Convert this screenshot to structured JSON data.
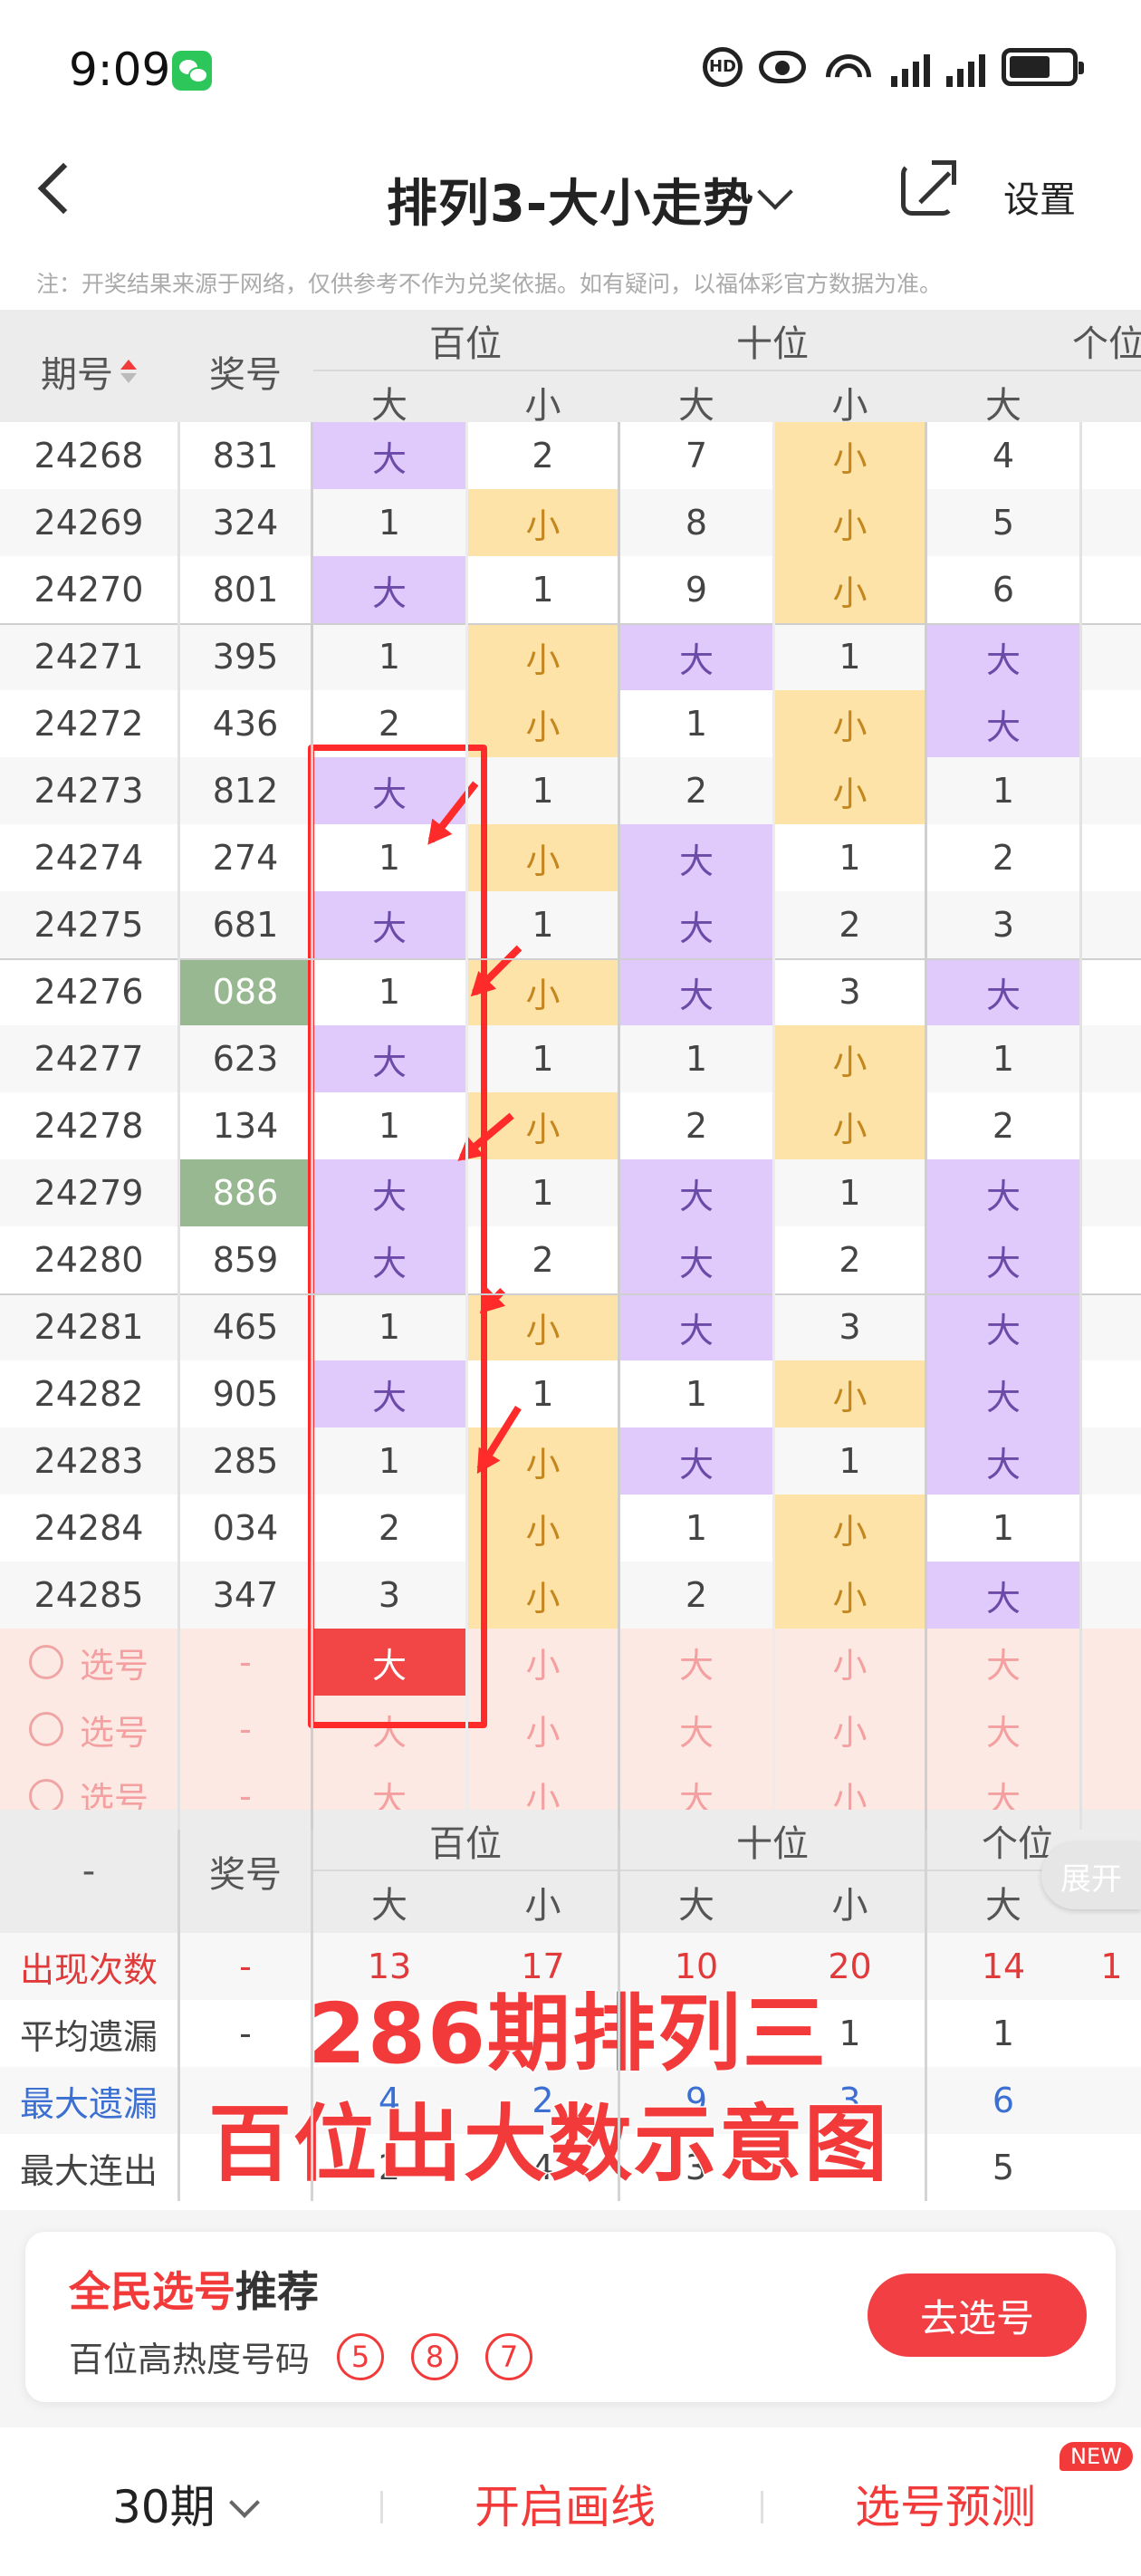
{
  "status": {
    "time": "9:09",
    "hd_label": "HD"
  },
  "nav": {
    "title": "排列3-大小走势",
    "settings": "设置"
  },
  "notice": "注：开奖结果来源于网络，仅供参考不作为兑奖依据。如有疑问，以福体彩官方数据为准。",
  "table": {
    "head": {
      "issue": "期号",
      "prize": "奖号",
      "groups": [
        "百位",
        "十位",
        "个位"
      ],
      "big": "大",
      "small": "小"
    },
    "rows": [
      {
        "issue": "24268",
        "prize": "831",
        "c": [
          "大",
          "2",
          "7",
          "小",
          "4",
          ""
        ]
      },
      {
        "issue": "24269",
        "prize": "324",
        "c": [
          "1",
          "小",
          "8",
          "小",
          "5",
          ""
        ]
      },
      {
        "issue": "24270",
        "prize": "801",
        "c": [
          "大",
          "1",
          "9",
          "小",
          "6",
          ""
        ]
      },
      {
        "issue": "24271",
        "prize": "395",
        "c": [
          "1",
          "小",
          "大",
          "1",
          "大",
          ""
        ]
      },
      {
        "issue": "24272",
        "prize": "436",
        "c": [
          "2",
          "小",
          "1",
          "小",
          "大",
          ""
        ]
      },
      {
        "issue": "24273",
        "prize": "812",
        "c": [
          "大",
          "1",
          "2",
          "小",
          "1",
          ""
        ]
      },
      {
        "issue": "24274",
        "prize": "274",
        "c": [
          "1",
          "小",
          "大",
          "1",
          "2",
          ""
        ]
      },
      {
        "issue": "24275",
        "prize": "681",
        "c": [
          "大",
          "1",
          "大",
          "2",
          "3",
          ""
        ]
      },
      {
        "issue": "24276",
        "prize": "088",
        "c": [
          "1",
          "小",
          "大",
          "3",
          "大",
          ""
        ]
      },
      {
        "issue": "24277",
        "prize": "623",
        "c": [
          "大",
          "1",
          "1",
          "小",
          "1",
          ""
        ]
      },
      {
        "issue": "24278",
        "prize": "134",
        "c": [
          "1",
          "小",
          "2",
          "小",
          "2",
          ""
        ]
      },
      {
        "issue": "24279",
        "prize": "886",
        "c": [
          "大",
          "1",
          "大",
          "1",
          "大",
          ""
        ]
      },
      {
        "issue": "24280",
        "prize": "859",
        "c": [
          "大",
          "2",
          "大",
          "2",
          "大",
          ""
        ]
      },
      {
        "issue": "24281",
        "prize": "465",
        "c": [
          "1",
          "小",
          "大",
          "3",
          "大",
          ""
        ]
      },
      {
        "issue": "24282",
        "prize": "905",
        "c": [
          "大",
          "1",
          "1",
          "小",
          "大",
          ""
        ]
      },
      {
        "issue": "24283",
        "prize": "285",
        "c": [
          "1",
          "小",
          "大",
          "1",
          "大",
          ""
        ]
      },
      {
        "issue": "24284",
        "prize": "034",
        "c": [
          "2",
          "小",
          "1",
          "小",
          "1",
          ""
        ]
      },
      {
        "issue": "24285",
        "prize": "347",
        "c": [
          "3",
          "小",
          "2",
          "小",
          "大",
          ""
        ]
      }
    ],
    "pick_rows": [
      {
        "label": "选号",
        "prize": "-",
        "c": [
          "大",
          "小",
          "大",
          "小",
          "大",
          ""
        ]
      },
      {
        "label": "选号",
        "prize": "-",
        "c": [
          "大",
          "小",
          "大",
          "小",
          "大",
          ""
        ]
      },
      {
        "label": "选号",
        "prize": "-",
        "c": [
          "大",
          "小",
          "大",
          "小",
          "大",
          ""
        ]
      }
    ]
  },
  "stats": {
    "head": {
      "dash": "-",
      "prize": "奖号",
      "groups": [
        "百位",
        "十位",
        "个位"
      ],
      "big": "大",
      "small": "小"
    },
    "expand": "展开",
    "rows": [
      {
        "label": "出现次数",
        "dash": "-",
        "c": [
          "13",
          "17",
          "10",
          "20",
          "14",
          "1"
        ],
        "color": "#e03a3a"
      },
      {
        "label": "平均遗漏",
        "dash": "-",
        "c": [
          "",
          "",
          "",
          "1",
          "1",
          ""
        ],
        "color": "#444"
      },
      {
        "label": "最大遗漏",
        "dash": "",
        "c": [
          "4",
          "2",
          "9",
          "3",
          "6",
          ""
        ],
        "color": "#3b6fd1"
      },
      {
        "label": "最大连出",
        "dash": "",
        "c": [
          "2",
          "4",
          "3",
          "",
          "5",
          ""
        ],
        "color": "#444"
      }
    ]
  },
  "overlay": {
    "line1": "286期排列三",
    "line2": "百位出大数示意图"
  },
  "recommend": {
    "title_red": "全民选号",
    "title_black": "推荐",
    "sub": "百位高热度号码",
    "balls": [
      "5",
      "8",
      "7"
    ],
    "button": "去选号"
  },
  "bottom": {
    "period": "30期",
    "draw": "开启画线",
    "predict": "选号预测",
    "new_badge": "NEW"
  },
  "colors": {
    "big": "#e0cafb",
    "small": "#fde3a8",
    "hit": "#97b891",
    "accent": "#f23a3a"
  }
}
